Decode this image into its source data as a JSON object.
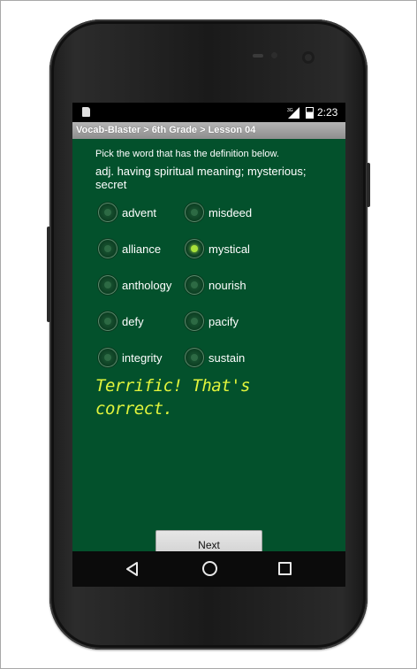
{
  "status_bar": {
    "network": "3G",
    "time": "2:23"
  },
  "app": {
    "breadcrumb": "Vocab-Blaster > 6th Grade > Lesson 04"
  },
  "question": {
    "prompt": "Pick the word that has the definition below.",
    "definition": "adj. having spiritual meaning; mysterious; secret"
  },
  "options": [
    {
      "label": "advent",
      "selected": false
    },
    {
      "label": "misdeed",
      "selected": false
    },
    {
      "label": "alliance",
      "selected": false
    },
    {
      "label": "mystical",
      "selected": true
    },
    {
      "label": "anthology",
      "selected": false
    },
    {
      "label": "nourish",
      "selected": false
    },
    {
      "label": "defy",
      "selected": false
    },
    {
      "label": "pacify",
      "selected": false
    },
    {
      "label": "integrity",
      "selected": false
    },
    {
      "label": "sustain",
      "selected": false
    }
  ],
  "feedback": "Terrific! That's correct.",
  "next_button": "Next",
  "nav": {
    "icons": [
      "back-icon",
      "home-icon",
      "recent-apps-icon"
    ]
  },
  "colors": {
    "content_bg": "#03512c",
    "feedback_text": "#e2f53c",
    "selected_radio": "#a8e23a"
  }
}
